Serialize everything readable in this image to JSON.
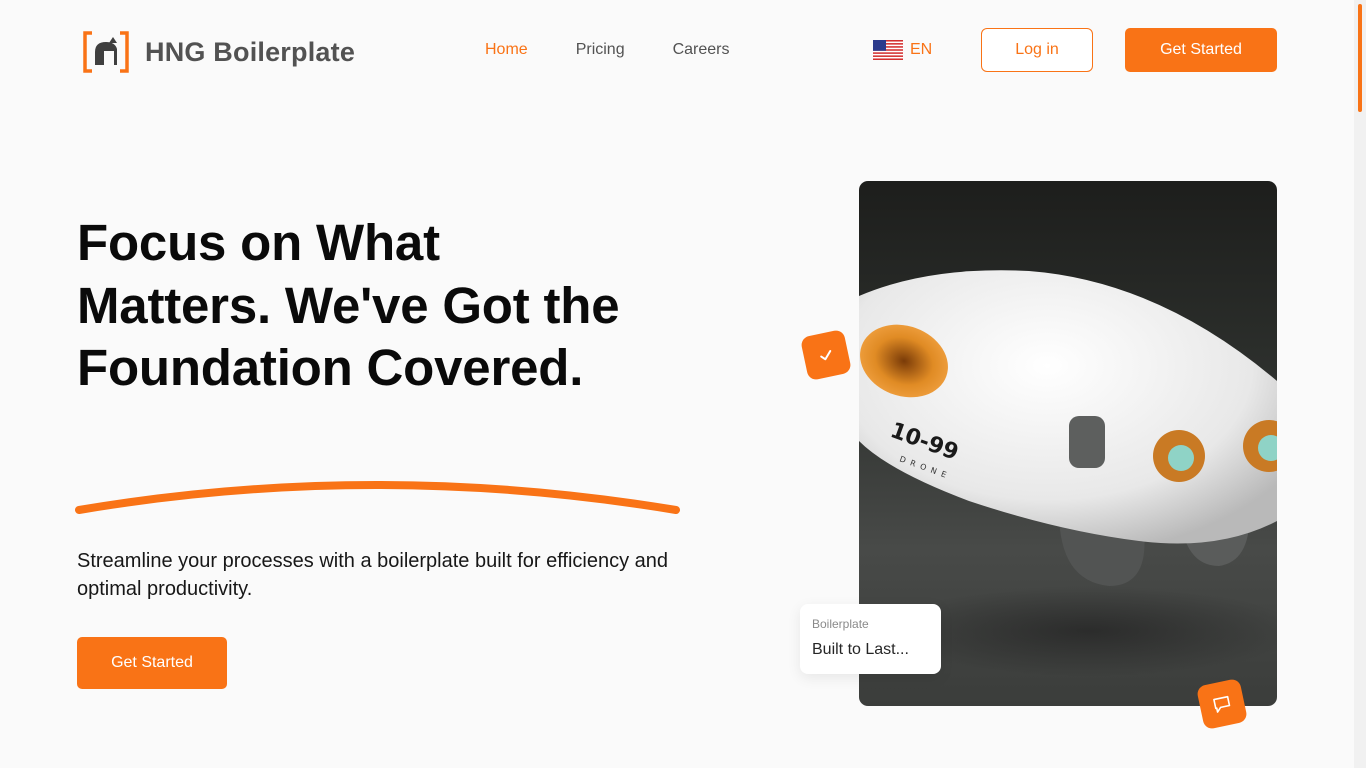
{
  "brand": {
    "name": "HNG Boilerplate",
    "accent": "#f97316"
  },
  "nav": {
    "items": [
      {
        "label": "Home",
        "active": true
      },
      {
        "label": "Pricing",
        "active": false
      },
      {
        "label": "Careers",
        "active": false
      }
    ]
  },
  "language": {
    "code": "EN",
    "flag": "us-flag-icon"
  },
  "header": {
    "login_label": "Log in",
    "cta_label": "Get Started"
  },
  "hero": {
    "title": "Focus on What Matters. We've Got the Foundation Covered.",
    "subtitle": "Streamline your processes with a boilerplate built for efficiency and optimal productivity.",
    "cta_label": "Get Started"
  },
  "showcase": {
    "badge_small": "Boilerplate",
    "badge_text": "Built to Last...",
    "product_label": "10-99",
    "product_sublabel": "DRONE",
    "check_icon": "check-icon",
    "chat_icon": "chat-icon"
  }
}
